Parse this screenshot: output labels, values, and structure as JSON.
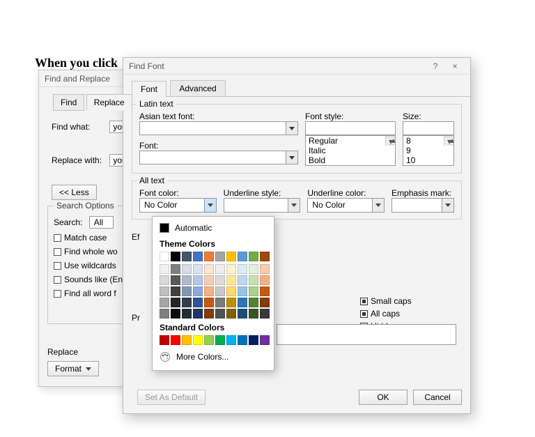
{
  "heading": "When you click",
  "find_replace": {
    "title": "Find and Replace",
    "tabs": {
      "find": "Find",
      "replace": "Replace"
    },
    "find_what_label": "Find what:",
    "find_what_value": "you",
    "replace_with_label": "Replace with:",
    "replace_with_value": "you",
    "less_button": "<< Less",
    "search_options_title": "Search Options",
    "search_label": "Search:",
    "search_value": "All",
    "checks": {
      "match_case": "Match case",
      "whole_words": "Find whole wo",
      "wildcards": "Use wildcards",
      "sounds_like": "Sounds like (En",
      "word_forms": "Find all word f"
    },
    "replace_section": "Replace",
    "format_button": "Format"
  },
  "find_font": {
    "title": "Find Font",
    "help": "?",
    "close": "×",
    "tabs": {
      "font": "Font",
      "advanced": "Advanced"
    },
    "latin_group": "Latin text",
    "asian_font_label": "Asian text font:",
    "font_label": "Font:",
    "font_style_label": "Font style:",
    "size_label": "Size:",
    "font_styles": [
      "Regular",
      "Italic",
      "Bold"
    ],
    "sizes": [
      "8",
      "9",
      "10"
    ],
    "all_text_group": "All text",
    "font_color_label": "Font color:",
    "font_color_value": "No Color",
    "underline_style_label": "Underline style:",
    "underline_style_value": "",
    "underline_color_label": "Underline color:",
    "underline_color_value": "No Color",
    "emphasis_label": "Emphasis mark:",
    "effects_prefix": "Ef",
    "effects": {
      "small_caps": "Small caps",
      "all_caps": "All caps",
      "hidden": "Hidden"
    },
    "preview_prefix": "Pr",
    "set_default": "Set As Default",
    "ok": "OK",
    "cancel": "Cancel"
  },
  "color_flyout": {
    "automatic": "Automatic",
    "theme_hdr": "Theme Colors",
    "standard_hdr": "Standard Colors",
    "more": "More Colors...",
    "theme_row": [
      "#ffffff",
      "#000000",
      "#44546a",
      "#4472c4",
      "#ed7d31",
      "#a5a5a5",
      "#ffc000",
      "#5b9bd5",
      "#70ad47",
      "#9e480e"
    ],
    "theme_shades": [
      [
        "#f2f2f2",
        "#7f7f7f",
        "#d6dce5",
        "#d9e1f2",
        "#fce4d6",
        "#ededed",
        "#fff2cc",
        "#ddebf7",
        "#e2efda",
        "#f8cbad"
      ],
      [
        "#d9d9d9",
        "#595959",
        "#adb9ca",
        "#b4c6e7",
        "#f8cbad",
        "#dbdbdb",
        "#ffe699",
        "#bdd7ee",
        "#c6e0b4",
        "#f4b084"
      ],
      [
        "#bfbfbf",
        "#404040",
        "#8497b0",
        "#8ea9db",
        "#f4b084",
        "#c9c9c9",
        "#ffd966",
        "#9bc2e6",
        "#a9d08e",
        "#c65911"
      ],
      [
        "#a6a6a6",
        "#262626",
        "#333f4f",
        "#305496",
        "#c65911",
        "#7b7b7b",
        "#bf8f00",
        "#2f75b5",
        "#548235",
        "#833c0c"
      ],
      [
        "#808080",
        "#0d0d0d",
        "#222b35",
        "#203764",
        "#833c0c",
        "#525252",
        "#806000",
        "#1f4e78",
        "#375623",
        "#3a3838"
      ]
    ],
    "standard": [
      "#c00000",
      "#ff0000",
      "#ffc000",
      "#ffff00",
      "#92d050",
      "#00b050",
      "#00b0f0",
      "#0070c0",
      "#002060",
      "#7030a0"
    ]
  }
}
